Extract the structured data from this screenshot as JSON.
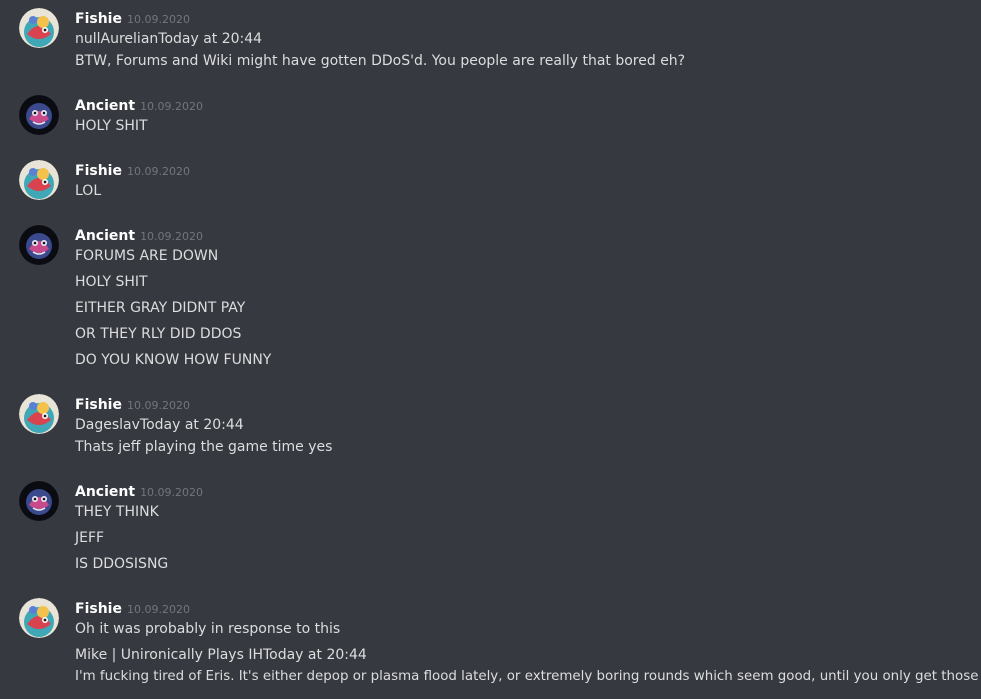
{
  "colors": {
    "background": "#36393f",
    "username": "#ffffff",
    "timestamp": "#72767d",
    "message_text": "#dcddde"
  },
  "messages": [
    {
      "author": "Fishie",
      "avatar": "fishie-avatar-icon",
      "timestamp": "10.09.2020",
      "lines": [
        "nullAurelianToday at 20:44",
        "BTW, Forums and Wiki might have gotten DDoS'd. You people are really that bored eh?"
      ]
    },
    {
      "author": "Ancient",
      "avatar": "ancient-avatar-icon",
      "timestamp": "10.09.2020",
      "lines": [
        "HOLY SHIT"
      ]
    },
    {
      "author": "Fishie",
      "avatar": "fishie-avatar-icon",
      "timestamp": "10.09.2020",
      "lines": [
        "LOL"
      ]
    },
    {
      "author": "Ancient",
      "avatar": "ancient-avatar-icon",
      "timestamp": "10.09.2020",
      "lines": [
        "FORUMS ARE DOWN",
        "HOLY SHIT",
        "EITHER GRAY DIDNT PAY",
        "OR THEY RLY DID DDOS",
        "DO YOU KNOW HOW FUNNY"
      ]
    },
    {
      "author": "Fishie",
      "avatar": "fishie-avatar-icon",
      "timestamp": "10.09.2020",
      "lines": [
        "DageslavToday at 20:44",
        "Thats jeff playing the game time yes"
      ]
    },
    {
      "author": "Ancient",
      "avatar": "ancient-avatar-icon",
      "timestamp": "10.09.2020",
      "lines": [
        "THEY THINK",
        "JEFF",
        "IS DDOSISNG"
      ]
    },
    {
      "author": "Fishie",
      "avatar": "fishie-avatar-icon",
      "timestamp": "10.09.2020",
      "lines": [
        "Oh it was probably in response to this",
        "Mike | Unironically Plays IHToday at 20:44",
        "I'm fucking tired of Eris. It's either depop or plasma flood lately, or extremely boring rounds which seem good, until you only get those"
      ]
    }
  ]
}
